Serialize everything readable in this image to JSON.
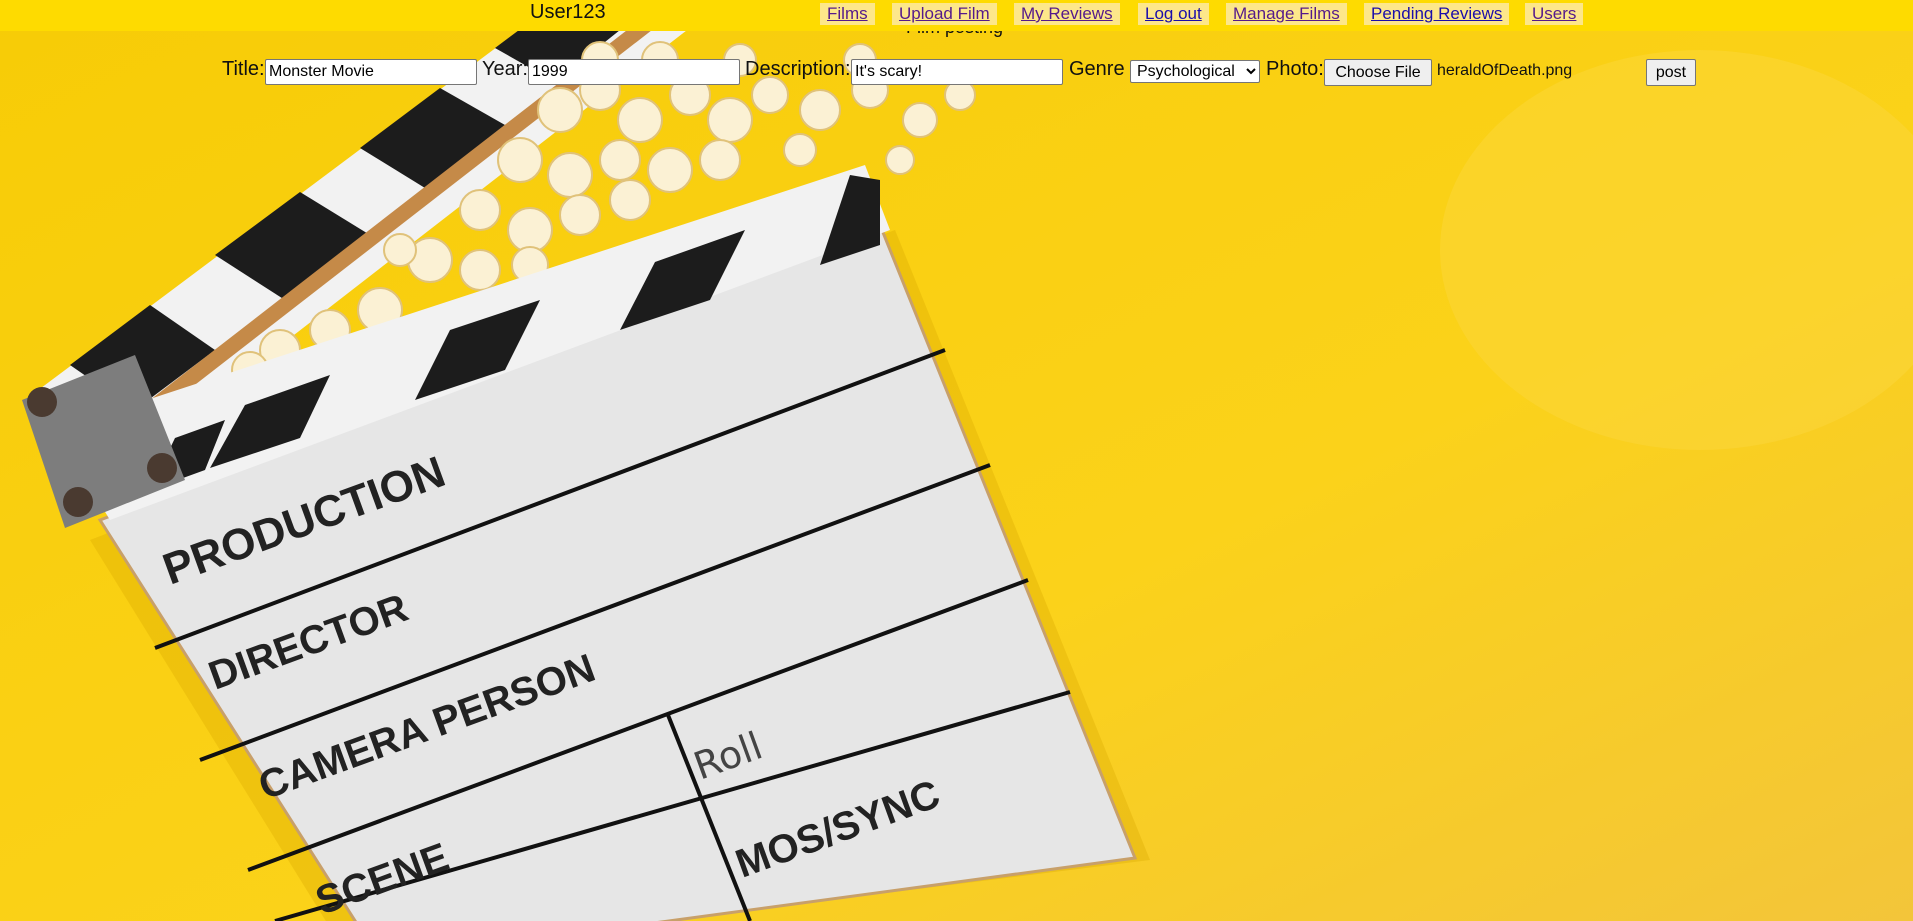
{
  "header": {
    "username": "User123",
    "posting_heading": "Film posting"
  },
  "nav": {
    "items": [
      {
        "label": "Films"
      },
      {
        "label": "Upload Film"
      },
      {
        "label": "My Reviews"
      },
      {
        "label": "Log out"
      },
      {
        "label": "Manage Films"
      },
      {
        "label": "Pending Reviews"
      },
      {
        "label": "Users"
      }
    ]
  },
  "form": {
    "title_label": "Title:",
    "title_value": "Monster Movie",
    "year_label": "Year:",
    "year_value": "1999",
    "description_label": "Description:",
    "description_value": "It's scary!",
    "genre_label": "Genre",
    "genre_selected": "Psychological",
    "photo_label": "Photo:",
    "choose_file_label": "Choose File",
    "file_name": "heraldOfDeath.png",
    "post_label": "post"
  },
  "background": {
    "description_label_1": "PRODUCTION",
    "description_label_2": "DIRECTOR",
    "description_label_3": "CAMERA PERSON",
    "description_label_4": "Roll",
    "description_label_5": "SCENE",
    "description_label_6": "MOS/SYNC",
    "colors": {
      "yellow": "#f9cf0f",
      "board": "#e4e4e4",
      "stripe": "#1c1c1c"
    }
  }
}
